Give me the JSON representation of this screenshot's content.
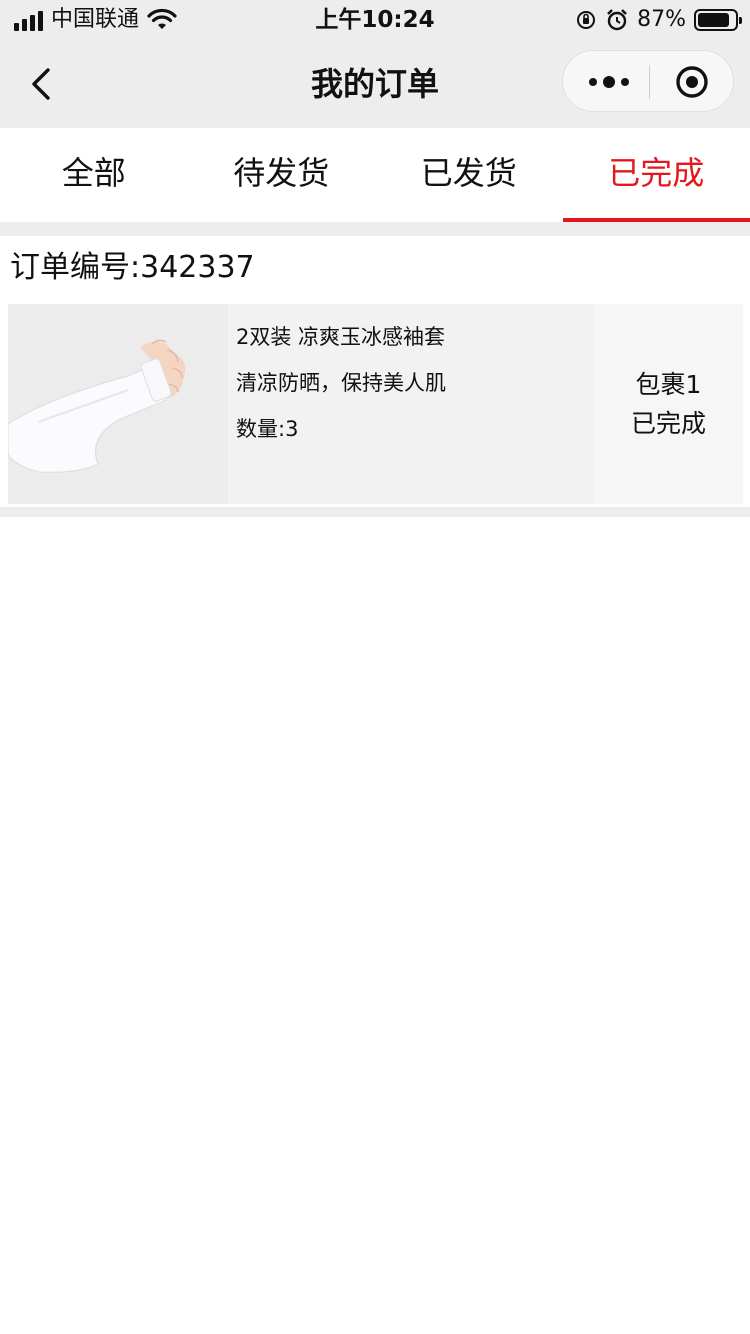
{
  "status_bar": {
    "carrier": "中国联通",
    "time": "上午10:24",
    "battery_percent": "87%",
    "battery_level": 0.87
  },
  "nav": {
    "title": "我的订单",
    "back_icon": "chevron-left-icon",
    "more_icon": "more-dots-icon",
    "close_icon": "target-icon"
  },
  "tabs": [
    {
      "label": "全部",
      "active": false
    },
    {
      "label": "待发货",
      "active": false
    },
    {
      "label": "已发货",
      "active": false
    },
    {
      "label": "已完成",
      "active": true
    }
  ],
  "accent_color": "#e4171c",
  "order": {
    "number_label": "订单编号:342337",
    "item": {
      "title": "2双装 凉爽玉冰感袖套",
      "subtitle": "清凉防晒，保持美人肌",
      "quantity": "数量:3",
      "package": "包裹1",
      "status": "已完成"
    }
  }
}
